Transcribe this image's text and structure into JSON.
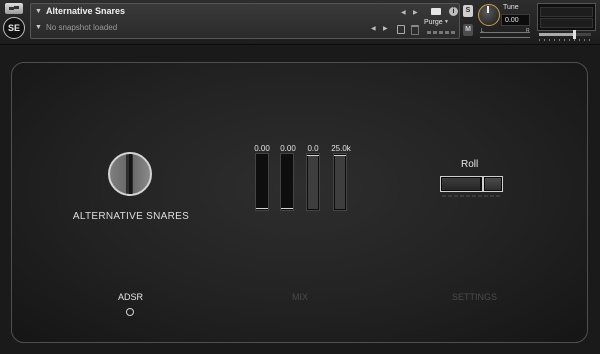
{
  "header": {
    "instrument_name": "Alternative Snares",
    "snapshot_text": "No snapshot loaded",
    "purge_label": "Purge",
    "info_icon_glyph": "i",
    "solo_label": "S",
    "mute_label": "M",
    "tune_label": "Tune",
    "tune_value": "0.00",
    "pan_left": "L",
    "pan_right": "R",
    "logo_text": "SE"
  },
  "panel": {
    "instrument_title": "ALTERNATIVE SNARES",
    "faders": [
      {
        "value": "0.00",
        "level": 0.0
      },
      {
        "value": "0.00",
        "level": 0.0
      },
      {
        "value": "0.0",
        "level": 1.0
      },
      {
        "value": "25.0k",
        "level": 1.0
      }
    ],
    "roll": {
      "label": "Roll",
      "state": "off"
    },
    "tabs": [
      {
        "label": "ADSR",
        "active": true
      },
      {
        "label": "MIX",
        "active": false
      },
      {
        "label": "SETTINGS",
        "active": false
      }
    ]
  },
  "colors": {
    "background": "#1a1a1a",
    "panel_border": "#4f4f4f",
    "tune_ring": "#cfa040",
    "text": "#dedede",
    "inactive_tab": "#4a4a4a"
  },
  "icons": [
    "wrench-icon",
    "camera-icon",
    "info-icon",
    "floppy-icon",
    "trash-icon",
    "prev-arrow-icon",
    "next-arrow-icon"
  ]
}
